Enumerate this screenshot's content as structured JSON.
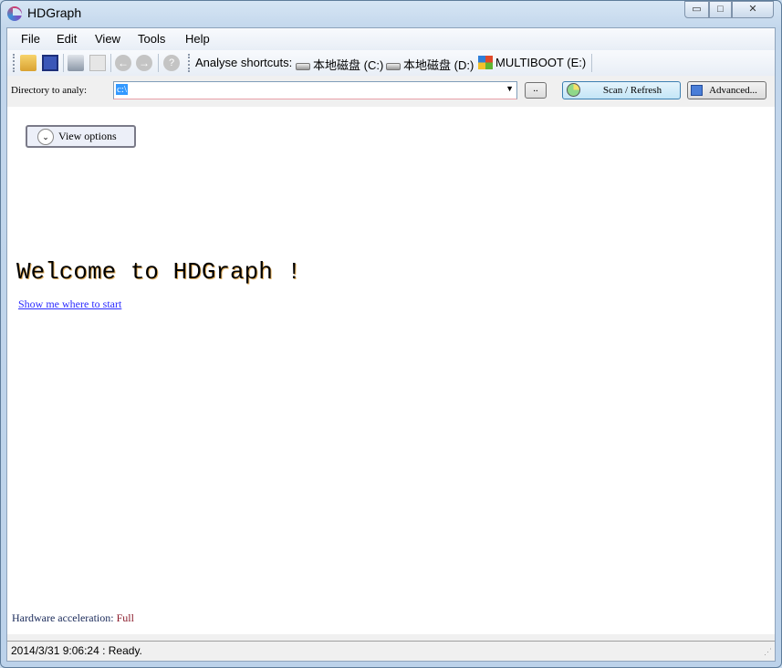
{
  "window": {
    "title": "HDGraph"
  },
  "menu": [
    "File",
    "Edit",
    "View",
    "Tools",
    "Help"
  ],
  "toolbar": {
    "shortcuts_label": "Analyse shortcuts:",
    "drives": [
      "本地磁盘 (C:)",
      "本地磁盘 (D:)",
      "MULTIBOOT (E:)"
    ]
  },
  "directory": {
    "label": "Directory to analy:",
    "value": "c:\\",
    "browse_label": "..",
    "scan_label": "Scan / Refresh",
    "advanced_label": "Advanced..."
  },
  "content": {
    "view_options": "View options",
    "welcome": "Welcome to HDGraph !",
    "start_link": "Show me where to start",
    "hw_label": "Hardware acceleration: ",
    "hw_value": "Full"
  },
  "status": {
    "text": "2014/3/31 9:06:24 : Ready."
  }
}
